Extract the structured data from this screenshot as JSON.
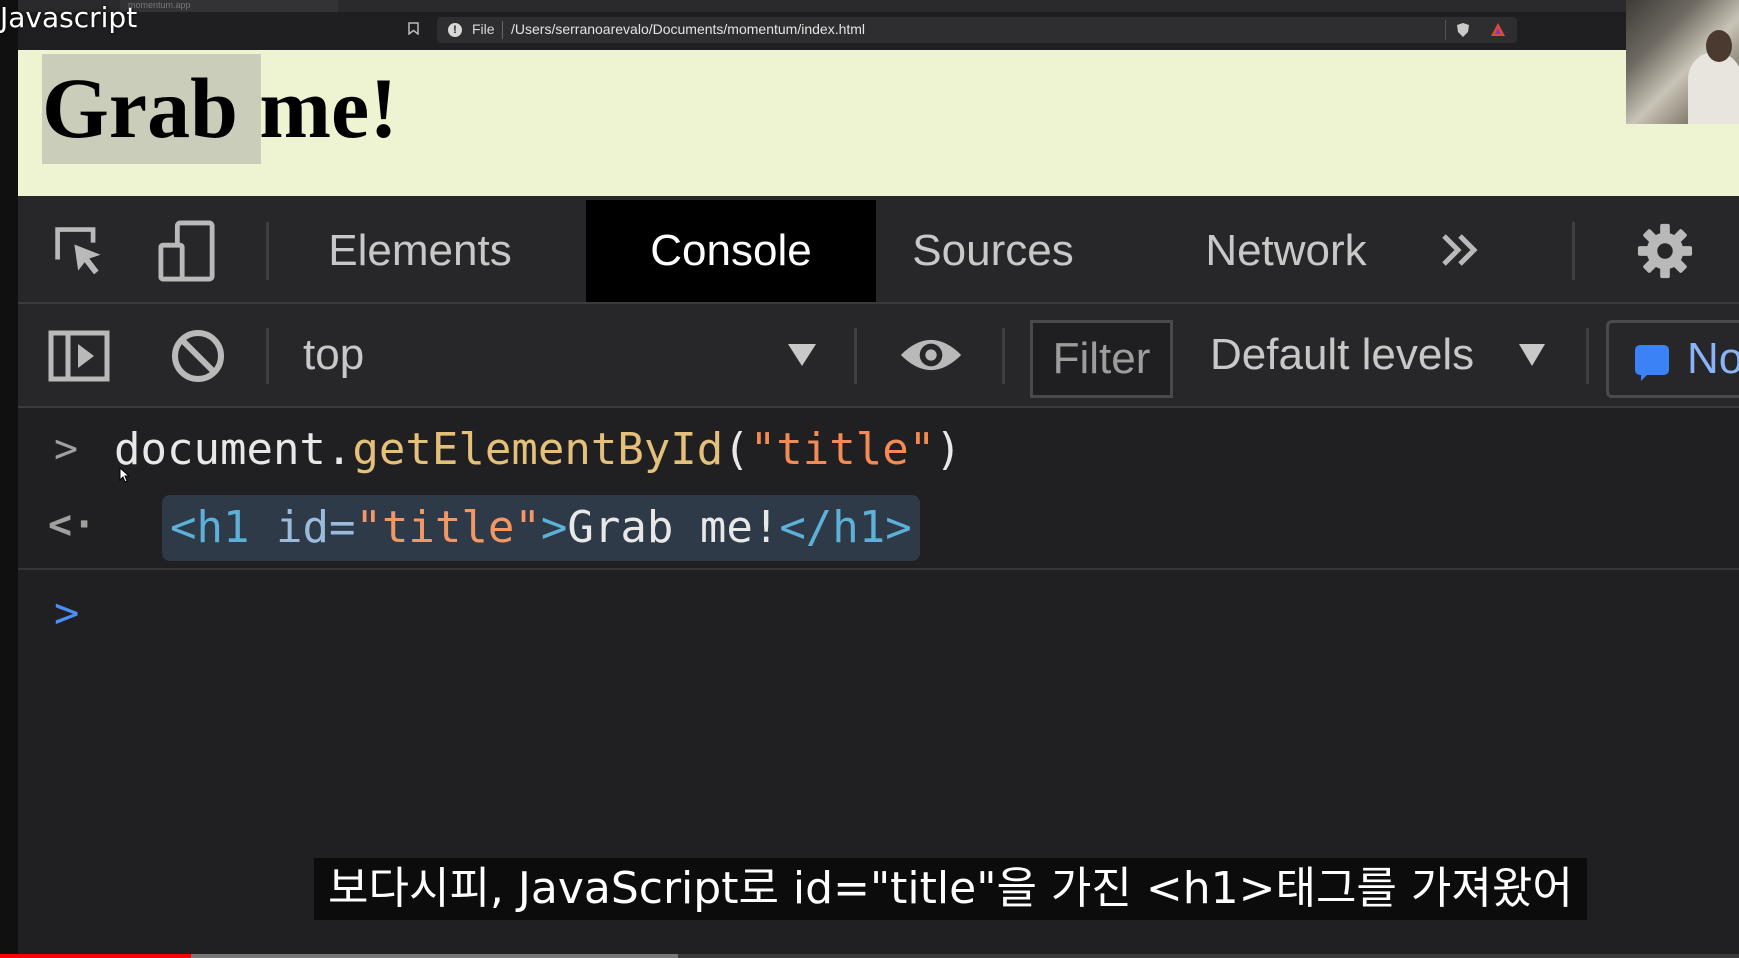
{
  "video": {
    "title": "Javascript",
    "subtitle": "보다시피, JavaScript로 id=\"title\"을 가진 <h1>태그를 가져왔어",
    "progress_fraction": 0.11,
    "buffered_fraction": 0.39
  },
  "browser": {
    "tab_label": "momentum.app",
    "address_scheme": "File",
    "url": "/Users/serranoarevalo/Documents/momentum/index.html"
  },
  "page": {
    "h1_text": "Grab me!",
    "background": "#eef3d2"
  },
  "devtools": {
    "tabs": [
      {
        "label": "Elements",
        "active": false
      },
      {
        "label": "Console",
        "active": true
      },
      {
        "label": "Sources",
        "active": false
      },
      {
        "label": "Network",
        "active": false
      }
    ],
    "more_tabs_icon": "double-chevron-right-icon",
    "settings_icon": "gear-icon",
    "console_toolbar": {
      "context": "top",
      "filter_placeholder": "Filter",
      "levels": "Default levels",
      "issues_label": "No"
    },
    "console": {
      "input_prompt": ">",
      "command": {
        "object": "document.",
        "method": "getElementById",
        "open": "(",
        "arg": "\"title\"",
        "close": ")"
      },
      "result_prompt": "<·",
      "result": {
        "open_tag_start": "<h1 ",
        "attr_name": "id=",
        "attr_value": "\"title\"",
        "open_tag_end": ">",
        "text": "Grab me!",
        "close_tag": "</h1>"
      },
      "active_prompt": ">"
    }
  },
  "colors": {
    "accent_blue": "#4c8df6",
    "function_yellow": "#e5c07b",
    "string_orange": "#f28b54",
    "tag_blue": "#5db0d7"
  }
}
